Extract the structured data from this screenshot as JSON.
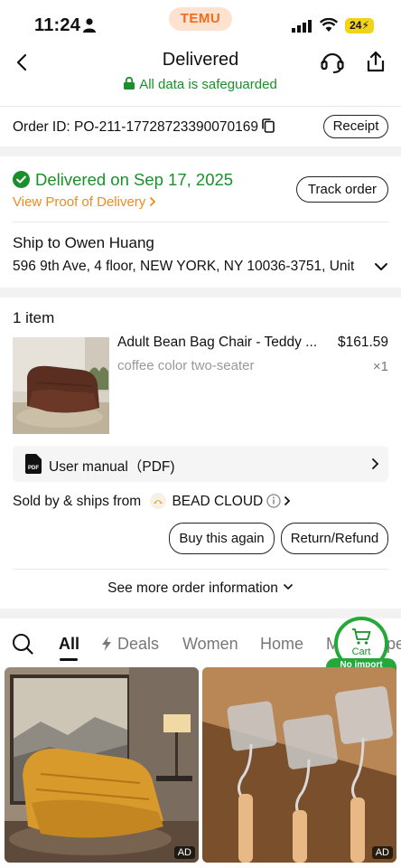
{
  "status_bar": {
    "time": "11:24",
    "brand": "TEMU",
    "battery": "24"
  },
  "header": {
    "title": "Delivered",
    "safeguard": "All data is safeguarded"
  },
  "order": {
    "id_text": "Order ID: PO-211-17728723390070169",
    "receipt_label": "Receipt"
  },
  "delivery": {
    "status": "Delivered on Sep 17, 2025",
    "proof_link": "View Proof of Delivery",
    "track_label": "Track order",
    "ship_to": "Ship to Owen Huang",
    "address": "596 9th Ave, 4 floor, NEW YORK, NY 10036-3751, Unit"
  },
  "items": {
    "count_label": "1 item",
    "product": {
      "name": "Adult Bean Bag Chair - Teddy ...",
      "price": "$161.59",
      "variant": "coffee color two-seater",
      "qty": "×1"
    },
    "manual_label": "User manual（PDF)",
    "sold_by": "Sold by & ships from",
    "store": "BEAD CLOUD",
    "buy_again": "Buy this again",
    "return_refund": "Return/Refund",
    "more_info": "See more order information"
  },
  "recommend": {
    "tabs": [
      "All",
      "Deals",
      "Women",
      "Home",
      "M",
      "pe"
    ],
    "cart_label": "Cart",
    "import_badge": "No import charges",
    "ad_label": "AD"
  },
  "colors": {
    "accent_green": "#1a8f2a",
    "accent_orange": "#f08a1c",
    "brand_orange": "#f26b1d"
  }
}
